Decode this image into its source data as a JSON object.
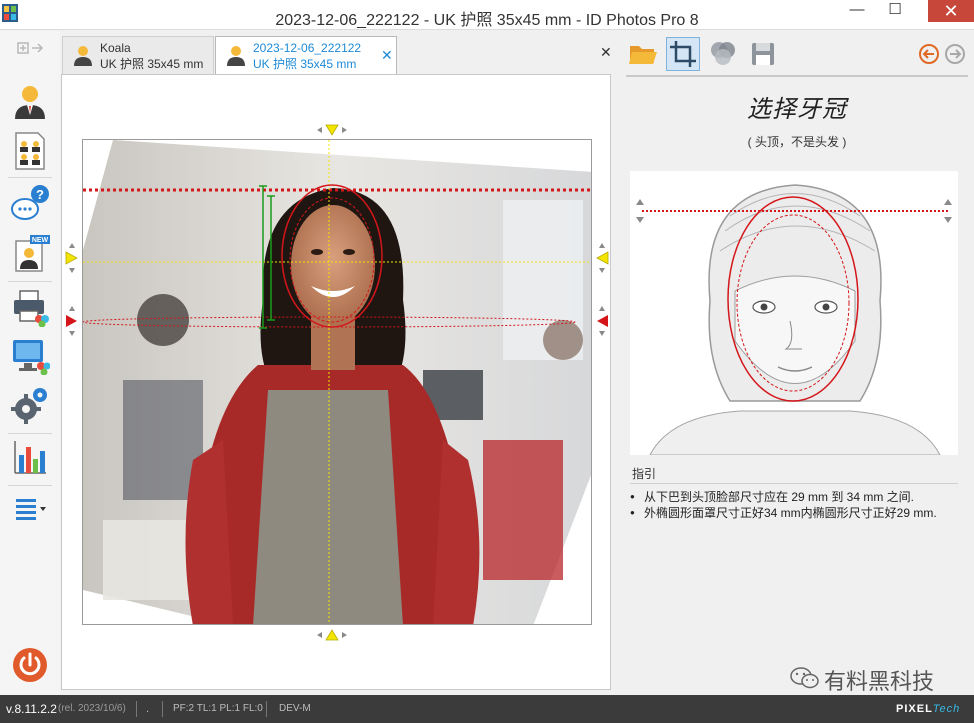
{
  "window": {
    "title": "2023-12-06_222122 - UK 护照 35x45 mm - ID Photos Pro 8",
    "minimize": "—",
    "maximize": "☐",
    "close": "✕"
  },
  "tabs": [
    {
      "title": "Koala",
      "subtitle": "UK 护照 35x45 mm",
      "active": false
    },
    {
      "title": "2023-12-06_222122",
      "subtitle": "UK 护照 35x45 mm",
      "active": true,
      "close": "✕"
    }
  ],
  "tabs_close_all": "✕",
  "right_panel": {
    "step_title": "选择牙冠",
    "step_subtitle": "( 头顶，不是头发 )",
    "guide_label": "指引",
    "guide_items": [
      "从下巴到头顶脸部尺寸应在 29 mm 到 34 mm 之间.",
      "外椭圆形面罩尺寸正好34 mm内椭圆形尺寸正好29 mm."
    ]
  },
  "watermark": "有料黑科技",
  "status": {
    "version": "v.8.11.2.2",
    "release": "(rel. 2023/10/6)",
    "dot": ".",
    "counters": "PF:2 TL:1 PL:1 FL:0",
    "mode": "DEV-M",
    "brand_a": "PIXEL",
    "brand_b": "Tech"
  },
  "colors": {
    "accent_blue": "#1e8ad6",
    "guide_red": "#d4161a",
    "guide_yellow": "#f3e500",
    "close_red": "#c7473b",
    "power_orange": "#e05a2b"
  }
}
